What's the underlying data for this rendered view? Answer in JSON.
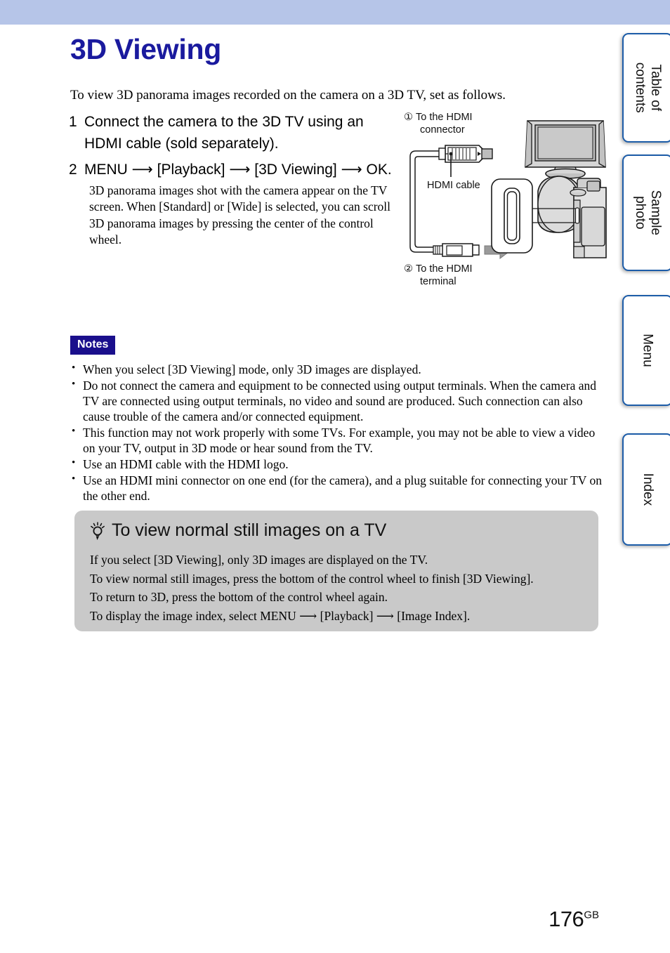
{
  "page": {
    "title": "3D Viewing",
    "intro": "To view 3D panorama images recorded on the camera on a 3D TV, set as follows.",
    "number": "176",
    "number_suffix": "GB"
  },
  "steps": [
    {
      "num": "1",
      "text": "Connect the camera to the 3D TV using an HDMI cable (sold separately).",
      "desc": ""
    },
    {
      "num": "2",
      "text": "MENU ⟶ [Playback] ⟶ [3D Viewing] ⟶ OK.",
      "desc": "3D panorama images shot with the camera appear on the TV screen.\nWhen [Standard] or [Wide] is selected, you can scroll 3D panorama images by pressing the center of the control wheel."
    }
  ],
  "diagram": {
    "label_1_marker": "①",
    "label_1": "To the HDMI\nconnector",
    "label_cable": "HDMI cable",
    "label_2_marker": "②",
    "label_2": "To the HDMI\nterminal",
    "parts": [
      "tv-icon",
      "hdmi-plug-icon",
      "hdmi-cable-icon",
      "hdmi-mini-plug-icon",
      "camera-icon",
      "hdmi-terminal-closeup-icon",
      "arrow-icon"
    ]
  },
  "notes": {
    "badge": "Notes",
    "items": [
      "When you select [3D Viewing] mode, only 3D images are displayed.",
      "Do not connect the camera and equipment to be connected using output terminals. When the camera and TV are connected using output terminals, no video and sound are produced. Such connection can also cause trouble of the camera and/or connected equipment.",
      "This function may not work properly with some TVs. For example, you may not be able to view a video on your TV, output in 3D mode or hear sound from the TV.",
      "Use an HDMI cable with the HDMI logo.",
      "Use an HDMI mini connector on one end (for the camera), and a plug suitable for connecting your TV on the other end."
    ]
  },
  "tip": {
    "icon": "lightbulb-icon",
    "heading": "To view normal still images on a TV",
    "lines": [
      "If you select [3D Viewing], only 3D images are displayed on the TV.",
      "To view normal still images, press the bottom of the control wheel to finish [3D Viewing].",
      "To return to 3D, press the bottom of the control wheel again.",
      "To display the image index, select MENU ⟶ [Playback] ⟶ [Image Index]."
    ]
  },
  "tabs": [
    {
      "label": "Table of\ncontents"
    },
    {
      "label": "Sample photo"
    },
    {
      "label": "Menu"
    },
    {
      "label": "Index"
    }
  ],
  "colors": {
    "top_band": "#b6c5e8",
    "title": "#1a1a9e",
    "notes_badge_bg": "#1a0f8c",
    "tip_bg": "#c9c9c9",
    "tab_border": "#1c5ca8"
  }
}
